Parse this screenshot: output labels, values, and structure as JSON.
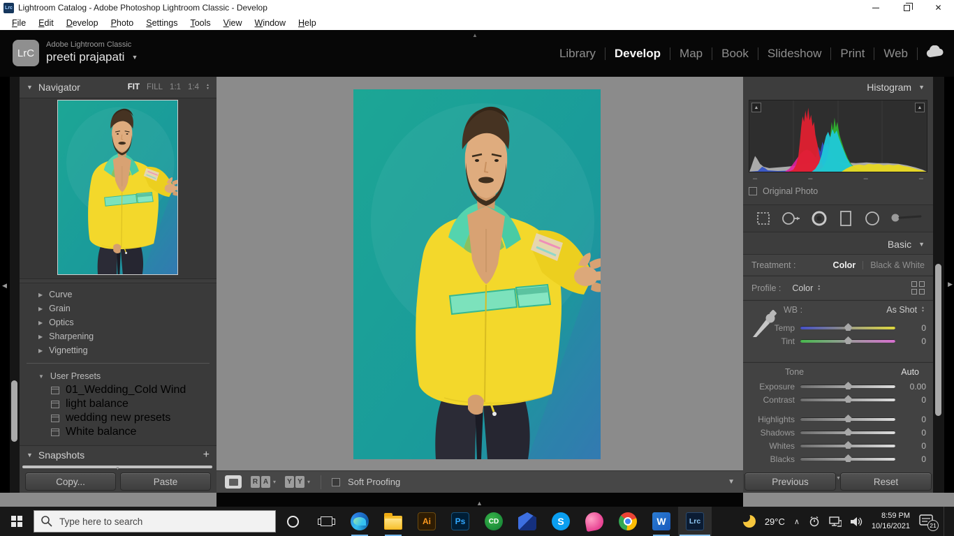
{
  "icons": {
    "triangle_down": "▼",
    "triangle_right": "▶",
    "triangle_up": "▲",
    "triangle_down_small": "▾",
    "plus": "+",
    "close": "✕",
    "chevron_up": "∧",
    "dotted_handle": "▲"
  },
  "window": {
    "app_badge": "Lrc",
    "title": "Lightroom Catalog - Adobe Photoshop Lightroom Classic - Develop"
  },
  "menubar": {
    "items": [
      "File",
      "Edit",
      "Develop",
      "Photo",
      "Settings",
      "Tools",
      "View",
      "Window",
      "Help"
    ]
  },
  "module_picker": {
    "logo": "LrC",
    "app_name": "Adobe Lightroom Classic",
    "user_name": "preeti prajapati",
    "modules": [
      "Library",
      "Develop",
      "Map",
      "Book",
      "Slideshow",
      "Print",
      "Web"
    ],
    "active_module": "Develop"
  },
  "left_panel": {
    "navigator": {
      "title": "Navigator",
      "zoom_options": [
        "FIT",
        "FILL",
        "1:1",
        "1:4"
      ],
      "active_zoom": "FIT"
    },
    "sections": [
      "Curve",
      "Grain",
      "Optics",
      "Sharpening",
      "Vignetting"
    ],
    "user_presets": {
      "title": "User Presets",
      "items": [
        "01_Wedding_Cold Wind",
        "light balance",
        "wedding new presets",
        "White balance"
      ]
    },
    "snapshots_title": "Snapshots",
    "copy_label": "Copy...",
    "paste_label": "Paste"
  },
  "toolbar": {
    "view_buttons": [
      "R",
      "A",
      "Y",
      "Y"
    ],
    "soft_proofing_label": "Soft Proofing"
  },
  "right_panel": {
    "histogram": {
      "title": "Histogram",
      "info": [
        "–",
        "–",
        "–",
        "–"
      ],
      "original_photo_label": "Original Photo"
    },
    "basic": {
      "title": "Basic",
      "treatment_label": "Treatment :",
      "treatment_options": [
        "Color",
        "Black & White"
      ],
      "treatment_active": "Color",
      "profile_label": "Profile :",
      "profile_value": "Color",
      "wb": {
        "label": "WB :",
        "value": "As Shot",
        "sliders": [
          {
            "label": "Temp",
            "value": "0"
          },
          {
            "label": "Tint",
            "value": "0"
          }
        ]
      },
      "tone": {
        "label": "Tone",
        "auto_label": "Auto",
        "sliders": [
          {
            "label": "Exposure",
            "value": "0.00"
          },
          {
            "label": "Contrast",
            "value": "0"
          },
          {
            "label": "Highlights",
            "value": "0"
          },
          {
            "label": "Shadows",
            "value": "0"
          },
          {
            "label": "Whites",
            "value": "0"
          },
          {
            "label": "Blacks",
            "value": "0"
          }
        ]
      }
    },
    "previous_label": "Previous",
    "reset_label": "Reset"
  },
  "taskbar": {
    "search_placeholder": "Type here to search",
    "app_icons": [
      "start",
      "search",
      "cortana",
      "task-view",
      "edge",
      "file-explorer",
      "illustrator",
      "photoshop",
      "coreldraw",
      "blue-app",
      "skype",
      "pink-app",
      "chrome",
      "word",
      "lightroom-classic"
    ],
    "icon_letters": {
      "illustrator": "Ai",
      "photoshop": "Ps",
      "coreldraw": "CD",
      "skype": "S",
      "word": "W",
      "lightroom": "Lrc"
    },
    "tray": {
      "temperature": "29°C",
      "time": "8:59 PM",
      "date": "10/16/2021",
      "notification_count": "21"
    }
  },
  "colors": {
    "accent_blue": "#31a8ff",
    "running_underline": "#76b9ed",
    "canvas_gray": "#8b8b8b",
    "photo_teal": "#1ca695",
    "jacket_yellow": "#f3d82b",
    "jacket_mint": "#7ce2bc"
  }
}
